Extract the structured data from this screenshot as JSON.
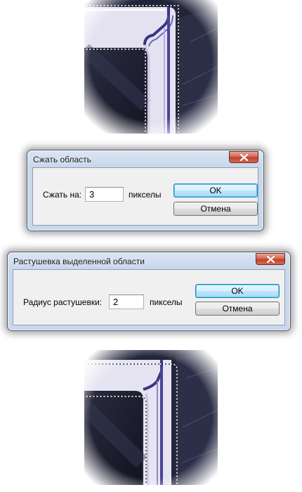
{
  "dialog_contract": {
    "title": "Сжать область",
    "field_label": "Сжать на:",
    "field_value": "3",
    "unit": "пикселы",
    "ok_label": "OK",
    "cancel_label": "Отмена"
  },
  "dialog_feather": {
    "title": "Растушевка выделенной области",
    "field_label": "Радиус растушевки:",
    "field_value": "2",
    "unit": "пикселы",
    "ok_label": "OK",
    "cancel_label": "Отмена"
  },
  "icons": {
    "close": "close-icon"
  },
  "colors": {
    "close_button": "#c9452d",
    "default_button": "#bee6fd",
    "frame_light": "#e7e4f3",
    "frame_stroke": "#403a86",
    "dark_surface": "#191b2a"
  }
}
